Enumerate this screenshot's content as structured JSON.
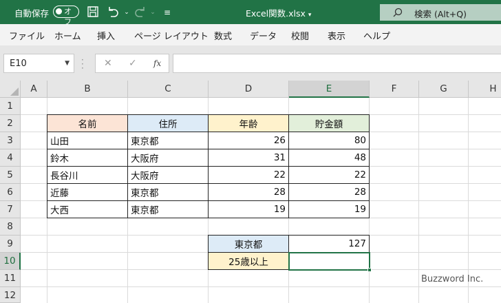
{
  "titlebar": {
    "autosave_label": "自動保存",
    "autosave_toggle": "オフ",
    "file_title": "Excel関数.xlsx",
    "search_label": "検索 (Alt+Q)"
  },
  "ribbon": {
    "tabs": [
      "ファイル",
      "ホーム",
      "挿入",
      "ページ レイアウト",
      "数式",
      "データ",
      "校閲",
      "表示",
      "ヘルプ"
    ]
  },
  "formula_bar": {
    "name_box": "E10",
    "cancel": "✕",
    "enter": "✓",
    "fx": "fx",
    "formula": ""
  },
  "sheet": {
    "columns": [
      "A",
      "B",
      "C",
      "D",
      "E",
      "F",
      "G",
      "H"
    ],
    "rows": [
      "1",
      "2",
      "3",
      "4",
      "5",
      "6",
      "7",
      "8",
      "9",
      "10",
      "11",
      "12"
    ],
    "active_cell": "E10",
    "header_row": {
      "B": "名前",
      "C": "住所",
      "D": "年齢",
      "E": "貯金額"
    },
    "data_rows": [
      {
        "name": "山田",
        "address": "東京都",
        "age": "26",
        "savings": "80"
      },
      {
        "name": "鈴木",
        "address": "大阪府",
        "age": "31",
        "savings": "48"
      },
      {
        "name": "長谷川",
        "address": "大阪府",
        "age": "22",
        "savings": "22"
      },
      {
        "name": "近藤",
        "address": "東京都",
        "age": "28",
        "savings": "28"
      },
      {
        "name": "大西",
        "address": "東京都",
        "age": "19",
        "savings": "19"
      }
    ],
    "summary": [
      {
        "label": "東京都",
        "value": "127"
      },
      {
        "label": "25歳以上",
        "value": ""
      }
    ],
    "colors": {
      "name_header": "#fce4d6",
      "address_header": "#ddebf7",
      "age_header": "#fff2cc",
      "savings_header": "#e2efda",
      "excel_green": "#217346"
    }
  },
  "watermark": "Buzzword Inc."
}
